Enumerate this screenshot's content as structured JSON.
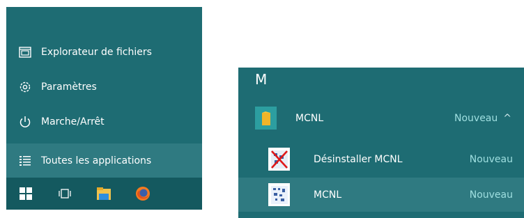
{
  "start_menu": {
    "items": [
      {
        "label": "Explorateur de fichiers",
        "icon": "file-explorer-icon"
      },
      {
        "label": "Paramètres",
        "icon": "gear-icon"
      },
      {
        "label": "Marche/Arrêt",
        "icon": "power-icon"
      },
      {
        "label": "Toutes les applications",
        "icon": "all-apps-icon"
      }
    ],
    "taskbar": [
      "windows-start-icon",
      "task-view-icon",
      "file-explorer-icon",
      "firefox-icon"
    ]
  },
  "apps_list": {
    "letter": "M",
    "folder": {
      "label": "MCNL",
      "badge": "Nouveau",
      "chevron": "^"
    },
    "entries": [
      {
        "label": "Désinstaller MCNL",
        "badge": "Nouveau",
        "icon": "uninstall-icon"
      },
      {
        "label": "MCNL",
        "badge": "Nouveau",
        "icon": "mcnl-app-icon"
      }
    ]
  },
  "colors": {
    "panel": "#1e6c73",
    "highlight": "#2f7a81",
    "taskbar": "#14595f",
    "badge": "#9fdfe0"
  }
}
